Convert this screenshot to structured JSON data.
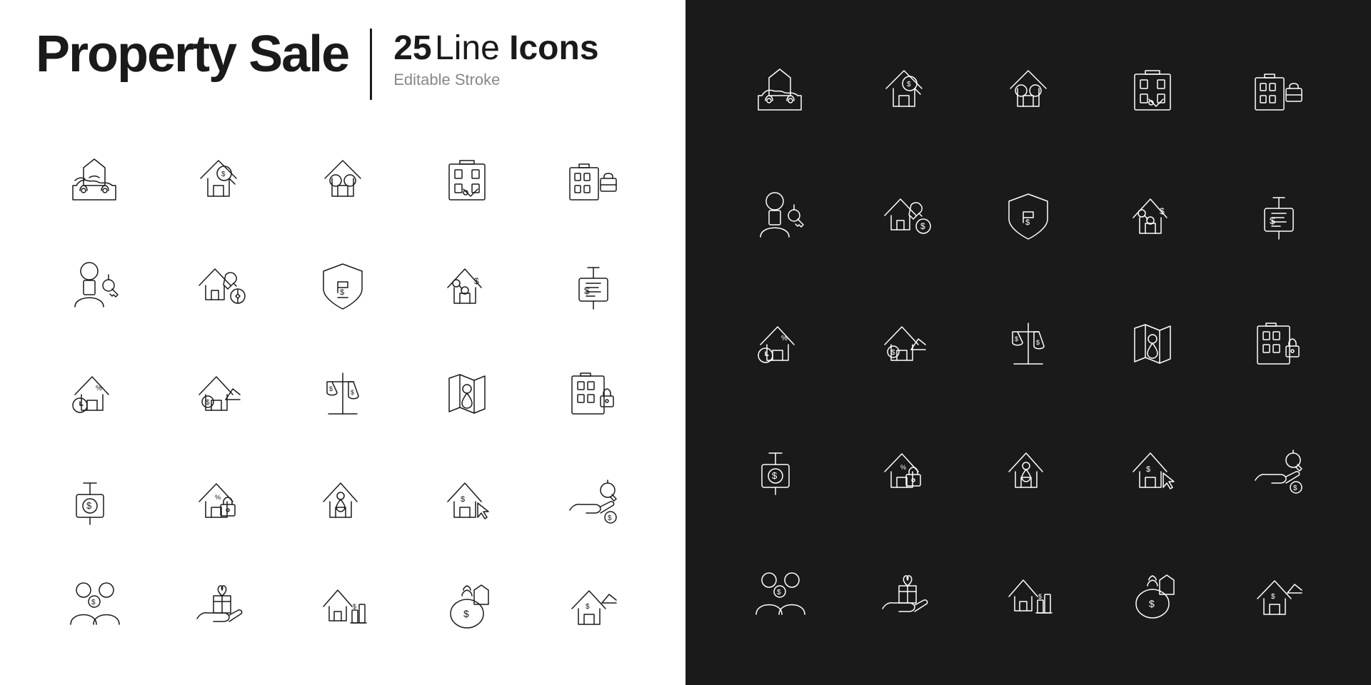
{
  "header": {
    "title": "Property Sale",
    "number": "25",
    "line_label": "Line",
    "icons_label": "Icons",
    "subtitle": "Editable Stroke"
  },
  "icons": [
    {
      "id": "house-handshake",
      "desc": "House with handshake - property deal"
    },
    {
      "id": "house-price-search",
      "desc": "House with price tag search"
    },
    {
      "id": "house-rings",
      "desc": "House with rings - property marriage/joint"
    },
    {
      "id": "apartment-keys",
      "desc": "Apartment building with keys"
    },
    {
      "id": "building-briefcase",
      "desc": "Building with briefcase"
    },
    {
      "id": "realtor-key",
      "desc": "Realtor person with key"
    },
    {
      "id": "house-wrench-money",
      "desc": "House with wrench and money bag"
    },
    {
      "id": "shield-price",
      "desc": "Shield with price tag - property insurance"
    },
    {
      "id": "house-price-scissors",
      "desc": "House with price cut scissors"
    },
    {
      "id": "sale-sign-price",
      "desc": "For sale sign with price"
    },
    {
      "id": "house-lock-time",
      "desc": "House with lock and clock - mortgage time"
    },
    {
      "id": "house-growth",
      "desc": "House with upward arrow - value growth"
    },
    {
      "id": "price-balance",
      "desc": "Price balance scale comparison"
    },
    {
      "id": "map-location",
      "desc": "Map with location pin"
    },
    {
      "id": "apartment-lock",
      "desc": "Apartment with lock"
    },
    {
      "id": "sale-sign-dollar",
      "desc": "Sale sign with dollar"
    },
    {
      "id": "house-percent-lock",
      "desc": "House with percent lock - mortgage"
    },
    {
      "id": "house-location-pin",
      "desc": "House with location pin"
    },
    {
      "id": "house-price-cursor",
      "desc": "House with price and cursor"
    },
    {
      "id": "hand-key-cash",
      "desc": "Hand giving key with cash"
    },
    {
      "id": "couple-dollar",
      "desc": "Couple with dollar - joint property"
    },
    {
      "id": "hand-gift-house",
      "desc": "Hand with gift bow - property gift"
    },
    {
      "id": "house-chart-dollar",
      "desc": "House with bar chart and dollar"
    },
    {
      "id": "money-bag-house",
      "desc": "Money bags with house"
    },
    {
      "id": "house-dollar-growth",
      "desc": "House with dollar growth arrow"
    }
  ]
}
